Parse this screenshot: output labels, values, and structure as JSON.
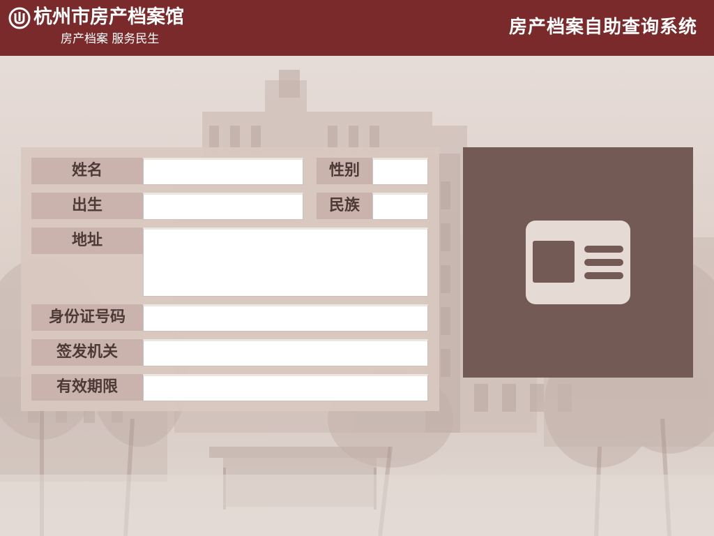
{
  "header": {
    "logo_icon": "archive-logo-icon",
    "title": "杭州市房产档案馆",
    "subtitle": "房产档案 服务民生",
    "system_title": "房产档案自助查询系统"
  },
  "form": {
    "name_label": "姓名",
    "name_value": "",
    "gender_label": "性别",
    "gender_value": "",
    "birth_label": "出生",
    "birth_value": "",
    "ethnicity_label": "民族",
    "ethnicity_value": "",
    "address_label": "地址",
    "address_value": "",
    "id_number_label": "身份证号码",
    "id_number_value": "",
    "issuer_label": "签发机关",
    "issuer_value": "",
    "validity_label": "有效期限",
    "validity_value": ""
  },
  "card_reader": {
    "icon": "id-card-icon"
  },
  "colors": {
    "header_bg": "#7a2a2b",
    "label_bg": "#c9b3ac",
    "card_panel_bg": "#735a54",
    "card_icon": "#e6dad5"
  }
}
